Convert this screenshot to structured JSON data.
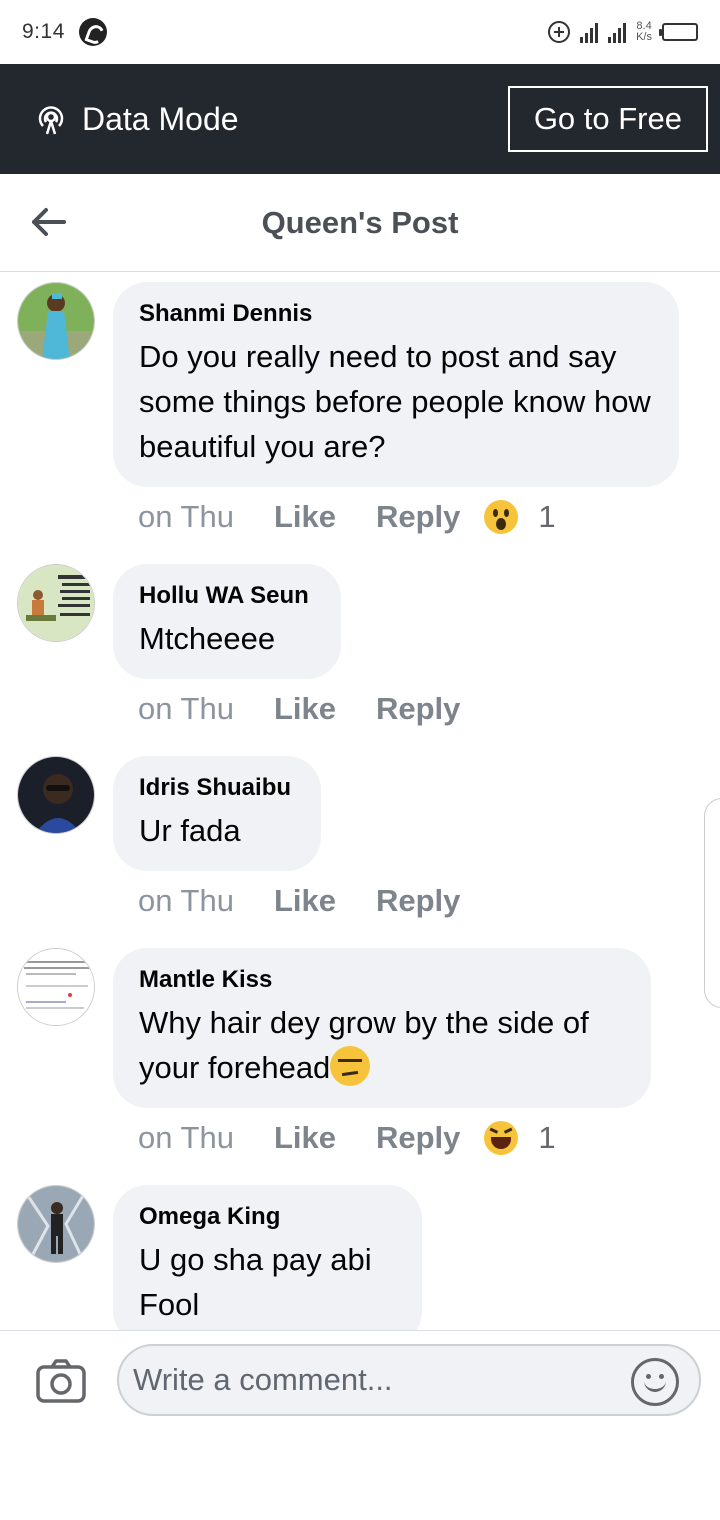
{
  "status_bar": {
    "time": "9:14",
    "net_speed_value": "8.4",
    "net_speed_unit": "K/s",
    "icons": [
      "whatsapp-icon",
      "plus-circle-icon",
      "signal-icon",
      "signal-icon",
      "battery-icon"
    ]
  },
  "banner": {
    "label": "Data Mode",
    "button_label": "Go to Free",
    "background": "#23272e"
  },
  "header": {
    "title": "Queen's Post"
  },
  "comments": [
    {
      "author": "Shanmi Dennis",
      "text": "Do you really need to post and say some things before people know how beautiful you are?",
      "time": "on Thu",
      "like": "Like",
      "reply": "Reply",
      "reaction": "wow",
      "reaction_count": "1"
    },
    {
      "author": "Hollu WA Seun",
      "text": "Mtcheeee",
      "time": "on Thu",
      "like": "Like",
      "reply": "Reply"
    },
    {
      "author": "Idris Shuaibu",
      "text": "Ur fada",
      "time": "on Thu",
      "like": "Like",
      "reply": "Reply"
    },
    {
      "author": "Mantle Kiss",
      "text": "Why hair dey grow by the side of your forehead",
      "time": "on Thu",
      "like": "Like",
      "reply": "Reply",
      "reaction": "haha",
      "reaction_count": "1"
    },
    {
      "author": "Omega King",
      "text": "U go sha pay abi Fool"
    }
  ],
  "composer": {
    "placeholder": "Write a comment..."
  },
  "colors": {
    "bubble": "#f0f2f5",
    "action_text": "#8d949e",
    "reaction_yellow": "#f7c33a"
  }
}
